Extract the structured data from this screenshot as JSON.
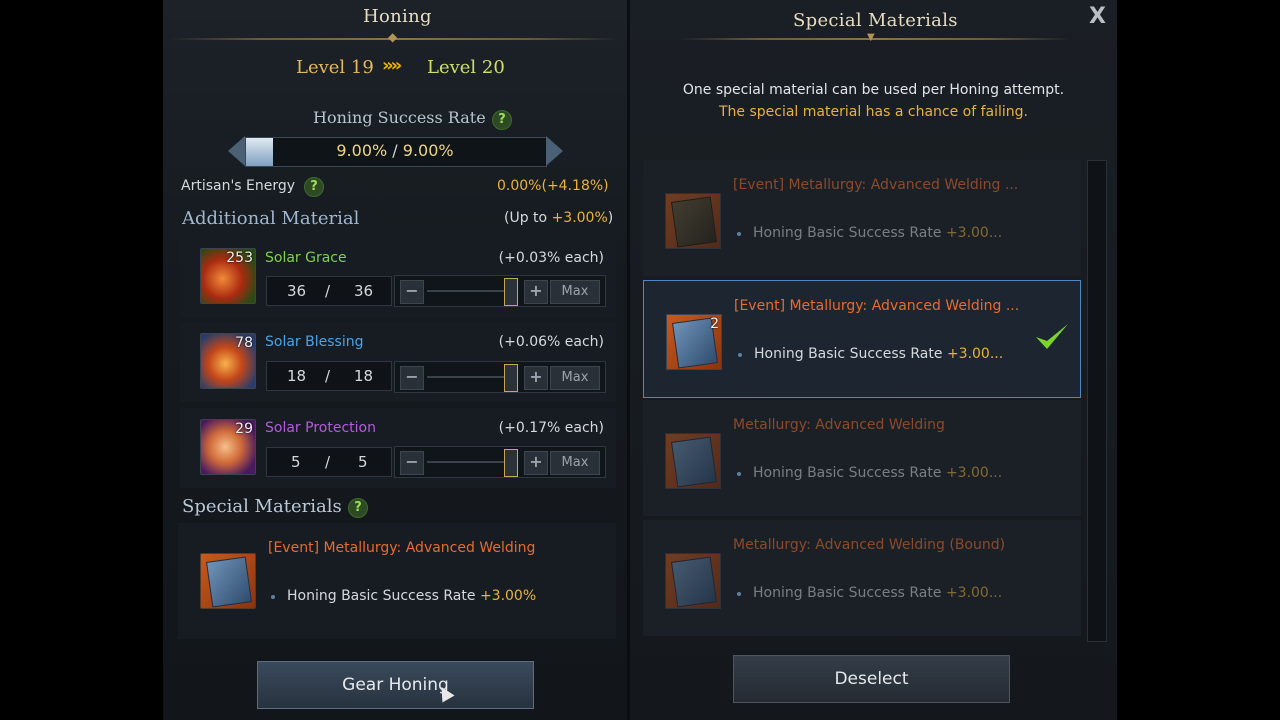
{
  "left_panel": {
    "title": "Honing",
    "level_from": "Level 19",
    "level_arrows": "»»",
    "level_to": "Level 20",
    "success_rate_title": "Honing Success Rate",
    "success_rate_current": "9.00%",
    "success_rate_separator": "/",
    "success_rate_max": "9.00%",
    "success_rate_fill_percent": 9,
    "artisans_energy_label": "Artisan's Energy",
    "artisans_energy_value": "0.00%",
    "artisans_energy_gain": "(+4.18%)",
    "additional_material_title": "Additional Material",
    "additional_cap_prefix": "(Up to ",
    "additional_cap_value": "+3.00%",
    "additional_cap_suffix": ")",
    "materials": [
      {
        "name": "Solar Grace",
        "count": "253",
        "each": "(+0.03% each)",
        "qty": "36",
        "slash": "/",
        "max": "36",
        "name_color": "#7fd14a",
        "max_label": "Max"
      },
      {
        "name": "Solar Blessing",
        "count": "78",
        "each": "(+0.06% each)",
        "qty": "18",
        "slash": "/",
        "max": "18",
        "name_color": "#4aa3e8",
        "max_label": "Max"
      },
      {
        "name": "Solar Protection",
        "count": "29",
        "each": "(+0.17% each)",
        "qty": "5",
        "slash": "/",
        "max": "5",
        "name_color": "#b55ae0",
        "max_label": "Max"
      }
    ],
    "special_materials_title": "Special Materials",
    "special_item_name": "[Event] Metallurgy: Advanced Welding",
    "special_item_stat": "Honing Basic Success Rate ",
    "special_item_stat_value": "+3.00%",
    "gear_honing_button": "Gear Honing"
  },
  "right_panel": {
    "title": "Special Materials",
    "close_label": "X",
    "notice_line1": "One special material can be used per Honing attempt.",
    "notice_line2": "The special material has a chance of failing.",
    "items": [
      {
        "name": "[Event] Metallurgy: Advanced Welding ...",
        "stat": "Honing Basic Success Rate ",
        "stat_value": "+3.00...",
        "count": "",
        "selected": false
      },
      {
        "name": "[Event] Metallurgy: Advanced Welding ...",
        "stat": "Honing Basic Success Rate ",
        "stat_value": "+3.00...",
        "count": "2",
        "selected": true
      },
      {
        "name": "Metallurgy: Advanced Welding",
        "stat": "Honing Basic Success Rate ",
        "stat_value": "+3.00...",
        "count": "",
        "selected": false
      },
      {
        "name": "Metallurgy: Advanced Welding (Bound)",
        "stat": "Honing Basic Success Rate ",
        "stat_value": "+3.00...",
        "count": "",
        "selected": false
      }
    ],
    "deselect_button": "Deselect"
  },
  "icons": {
    "help": "question-icon",
    "close": "close-icon",
    "check": "checkmark-icon",
    "minus": "minus-icon",
    "plus": "plus-icon"
  },
  "colors": {
    "gold": "#e9b23c",
    "event_orange": "#e86b2e",
    "selected_border": "#4f86c4",
    "check_green": "#7cd42b"
  }
}
